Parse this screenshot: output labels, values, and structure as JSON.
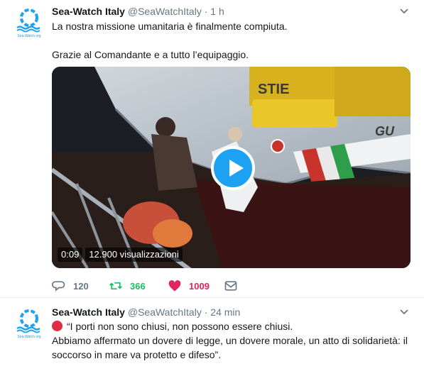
{
  "colors": {
    "accent": "#1da1f2",
    "retweet": "#17bf63",
    "like": "#e0245e",
    "muted": "#657786"
  },
  "tweets": [
    {
      "author": "Sea-Watch Italy",
      "handle": "@SeaWatchItaly",
      "sep": "·",
      "time": "1 h",
      "lines": [
        "La nostra missione umanitaria è finalmente compiuta.",
        "",
        "Grazie al Comandante e a tutto l’equipaggio."
      ],
      "avatar_caption": "Sea-Watch.org",
      "video": {
        "duration": "0:09",
        "views": "12.900 visualizzazioni",
        "hull_lettering": "GU",
        "crate_lettering": "STIE"
      },
      "stats": {
        "replies": "120",
        "retweets": "366",
        "likes": "1009"
      },
      "icons": [
        "reply-icon",
        "retweet-icon",
        "heart-icon",
        "mail-icon"
      ]
    },
    {
      "author": "Sea-Watch Italy",
      "handle": "@SeaWatchItaly",
      "sep": "·",
      "time": "24 min",
      "avatar_caption": "Sea-Watch.org",
      "lines": [
        "“I porti non sono chiusi, non possono essere chiusi.",
        "Abbiamo affermato un dovere di legge, un dovere morale, un atto di solidarietà: il",
        "soccorso in mare va protetto e difeso”."
      ],
      "emoji": "red-circle"
    }
  ]
}
